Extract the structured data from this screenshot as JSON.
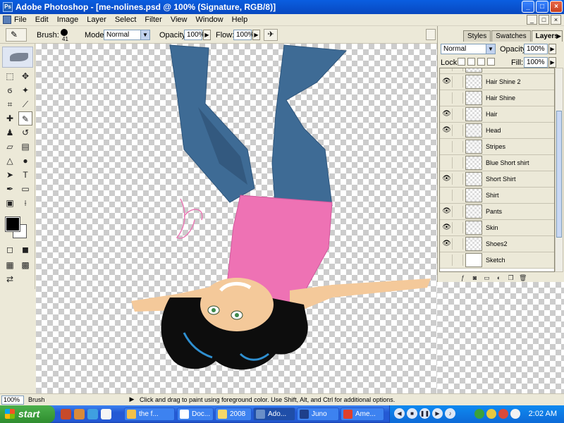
{
  "window": {
    "title": "Adobe Photoshop - [me-nolines.psd @ 100% (Signature, RGB/8)]",
    "controls": [
      "_",
      "□",
      "×"
    ]
  },
  "menu": {
    "items": [
      "File",
      "Edit",
      "Image",
      "Layer",
      "Select",
      "Filter",
      "View",
      "Window",
      "Help"
    ]
  },
  "options": {
    "brush_label": "Brush:",
    "brush_size": "41",
    "mode_label": "Mode:",
    "mode_value": "Normal",
    "opacity_label": "Opacity:",
    "opacity_value": "100%",
    "flow_label": "Flow:",
    "flow_value": "100%"
  },
  "layers_panel": {
    "tabs": [
      "Styles",
      "Swatches",
      "Layers"
    ],
    "active_tab": "Layers",
    "blend_mode": "Normal",
    "opacity_label": "Opacity:",
    "opacity_value": "100%",
    "lock_label": "Lock:",
    "fill_label": "Fill:",
    "fill_value": "100%",
    "layers": [
      {
        "name": "Hair Shine 2",
        "visible": true
      },
      {
        "name": "Hair Shine",
        "visible": false
      },
      {
        "name": "Hair",
        "visible": true
      },
      {
        "name": "Head",
        "visible": true
      },
      {
        "name": "Stripes",
        "visible": false
      },
      {
        "name": "Blue Short shirt",
        "visible": false
      },
      {
        "name": "Short Shirt",
        "visible": true
      },
      {
        "name": "Shirt",
        "visible": false
      },
      {
        "name": "Pants",
        "visible": true
      },
      {
        "name": "Skin",
        "visible": true
      },
      {
        "name": "Shoes2",
        "visible": true
      },
      {
        "name": "Sketch",
        "visible": false
      }
    ]
  },
  "status": {
    "zoom": "100%",
    "tool": "Brush",
    "hint": "Click and drag to paint using foreground color.  Use Shift, Alt, and Ctrl for additional options."
  },
  "taskbar": {
    "start_label": "start",
    "tasks": [
      "the f...",
      "Doc...",
      "2008",
      "Ado...",
      "Juno",
      "Ame..."
    ],
    "active_task": "Ado...",
    "clock": "2:02 AM"
  },
  "colors": {
    "jeans": "#3e6b95",
    "shirt": "#ee72b4",
    "skin": "#f4c99a",
    "hair": "#0d0d0d",
    "hair_shine": "#2f8fd0"
  }
}
